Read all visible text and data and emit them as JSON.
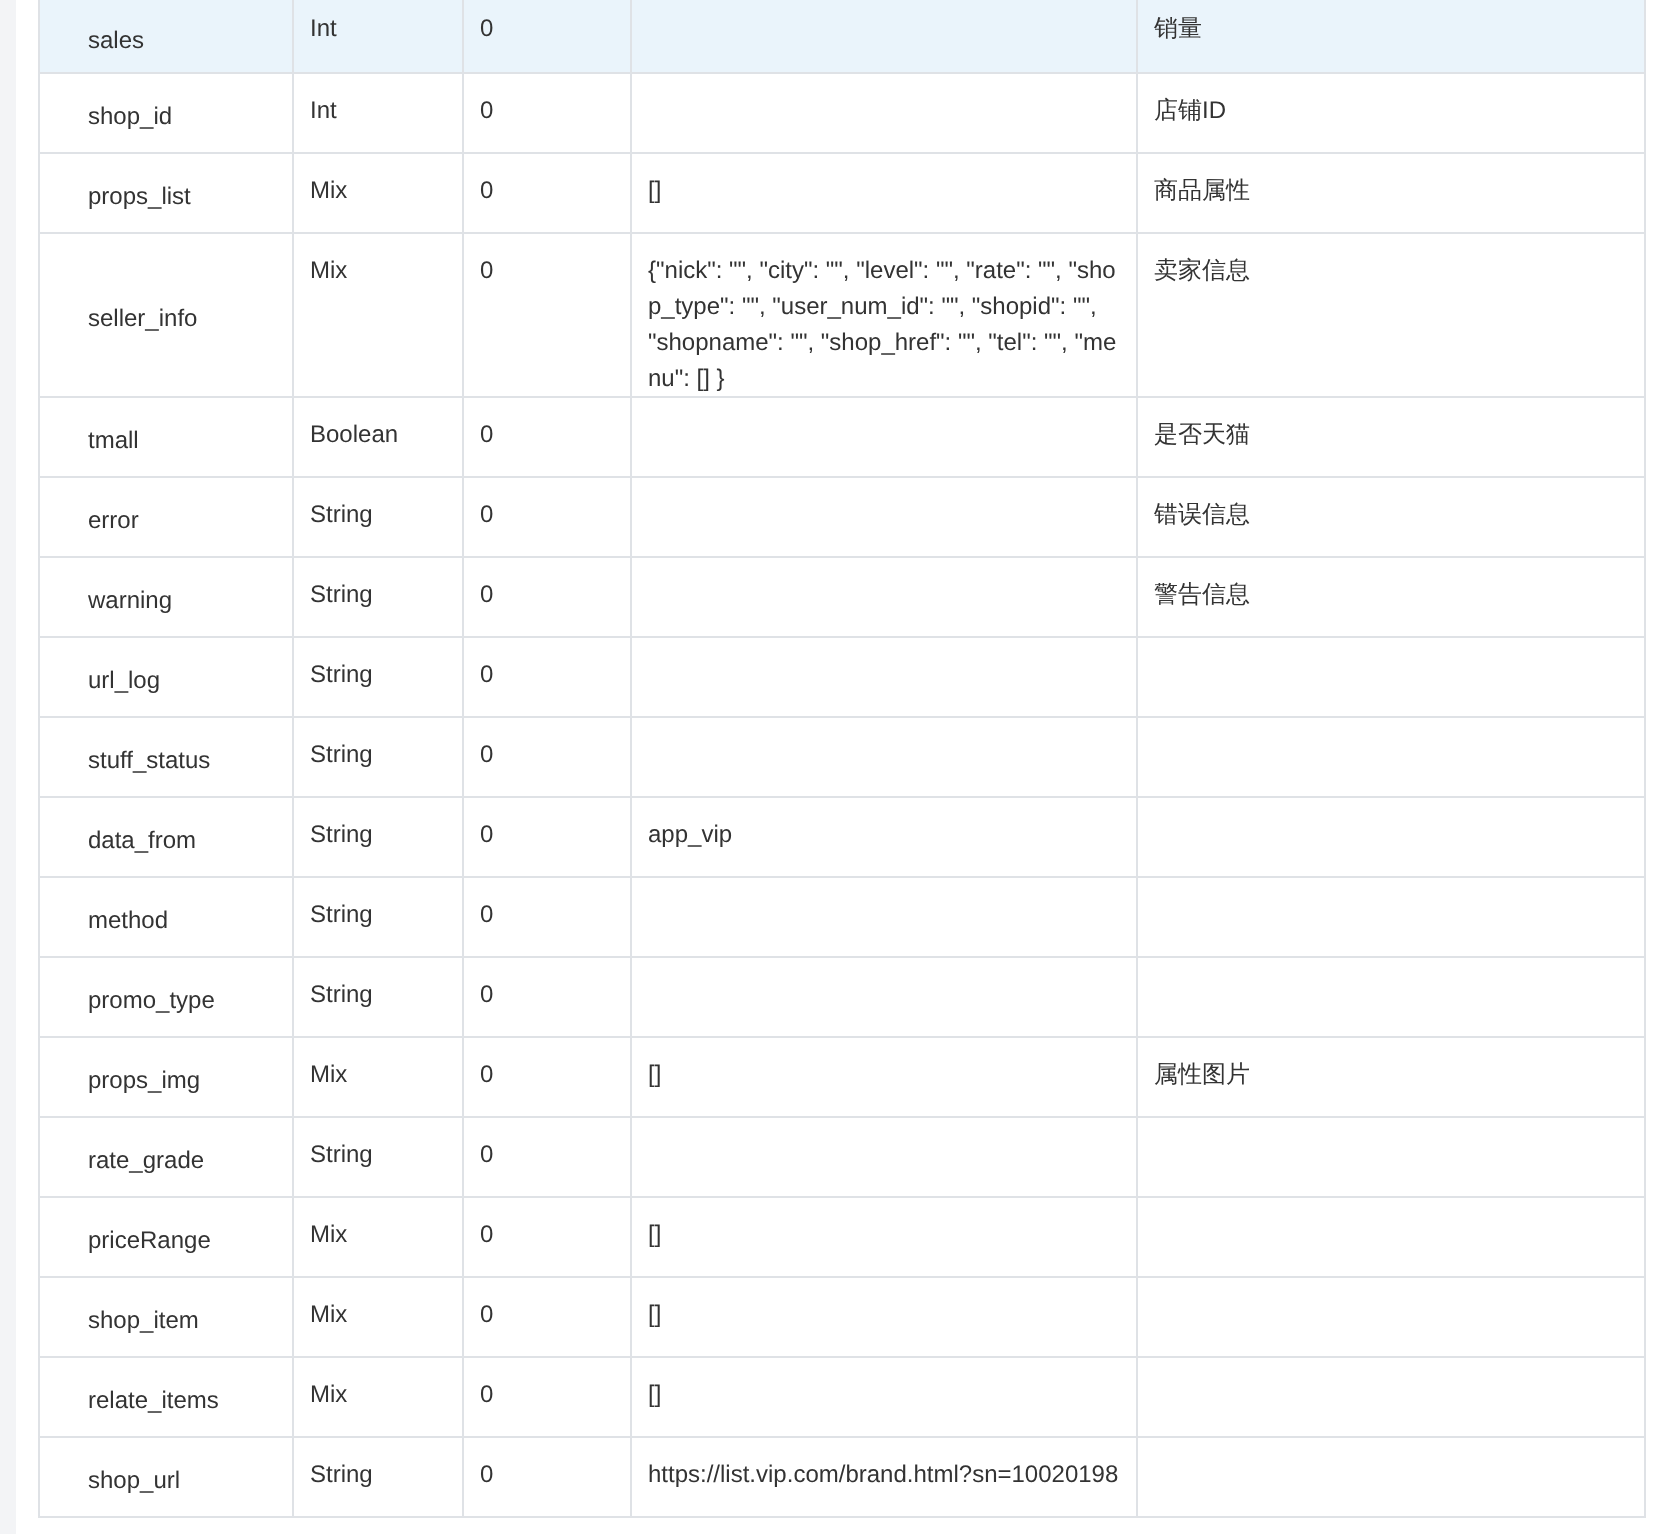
{
  "rows": [
    {
      "name": "sales",
      "type": "Int",
      "column_3": "0",
      "column_4": "",
      "column_5": "销量",
      "highlighted": true
    },
    {
      "name": "shop_id",
      "type": "Int",
      "column_3": "0",
      "column_4": "",
      "column_5": "店铺ID",
      "highlighted": false
    },
    {
      "name": "props_list",
      "type": "Mix",
      "column_3": "0",
      "column_4": "[]",
      "column_5": "商品属性",
      "highlighted": false
    },
    {
      "name": "seller_info",
      "type": "Mix",
      "column_3": "0",
      "column_4": "{\"nick\": \"\", \"city\": \"\", \"level\": \"\", \"rate\": \"\", \"shop_type\": \"\", \"user_num_id\": \"\", \"shopid\": \"\", \"shopname\": \"\", \"shop_href\": \"\", \"tel\": \"\", \"menu\": [] }",
      "column_5": "卖家信息",
      "highlighted": false
    },
    {
      "name": "tmall",
      "type": "Boolean",
      "column_3": "0",
      "column_4": "",
      "column_5": "是否天猫",
      "highlighted": false
    },
    {
      "name": "error",
      "type": "String",
      "column_3": "0",
      "column_4": "",
      "column_5": "错误信息",
      "highlighted": false
    },
    {
      "name": "warning",
      "type": "String",
      "column_3": "0",
      "column_4": "",
      "column_5": "警告信息",
      "highlighted": false
    },
    {
      "name": "url_log",
      "type": "String",
      "column_3": "0",
      "column_4": "",
      "column_5": "",
      "highlighted": false
    },
    {
      "name": "stuff_status",
      "type": "String",
      "column_3": "0",
      "column_4": "",
      "column_5": "",
      "highlighted": false
    },
    {
      "name": "data_from",
      "type": "String",
      "column_3": "0",
      "column_4": "app_vip",
      "column_5": "",
      "highlighted": false
    },
    {
      "name": "method",
      "type": "String",
      "column_3": "0",
      "column_4": "",
      "column_5": "",
      "highlighted": false
    },
    {
      "name": "promo_type",
      "type": "String",
      "column_3": "0",
      "column_4": "",
      "column_5": "",
      "highlighted": false
    },
    {
      "name": "props_img",
      "type": "Mix",
      "column_3": "0",
      "column_4": "[]",
      "column_5": "属性图片",
      "highlighted": false
    },
    {
      "name": "rate_grade",
      "type": "String",
      "column_3": "0",
      "column_4": "",
      "column_5": "",
      "highlighted": false
    },
    {
      "name": "priceRange",
      "type": "Mix",
      "column_3": "0",
      "column_4": "[]",
      "column_5": "",
      "highlighted": false
    },
    {
      "name": "shop_item",
      "type": "Mix",
      "column_3": "0",
      "column_4": "[]",
      "column_5": "",
      "highlighted": false
    },
    {
      "name": "relate_items",
      "type": "Mix",
      "column_3": "0",
      "column_4": "[]",
      "column_5": "",
      "highlighted": false
    },
    {
      "name": "shop_url",
      "type": "String",
      "column_3": "0",
      "column_4": "https://list.vip.com/brand.html?sn=10020198",
      "column_5": "",
      "highlighted": false
    }
  ]
}
